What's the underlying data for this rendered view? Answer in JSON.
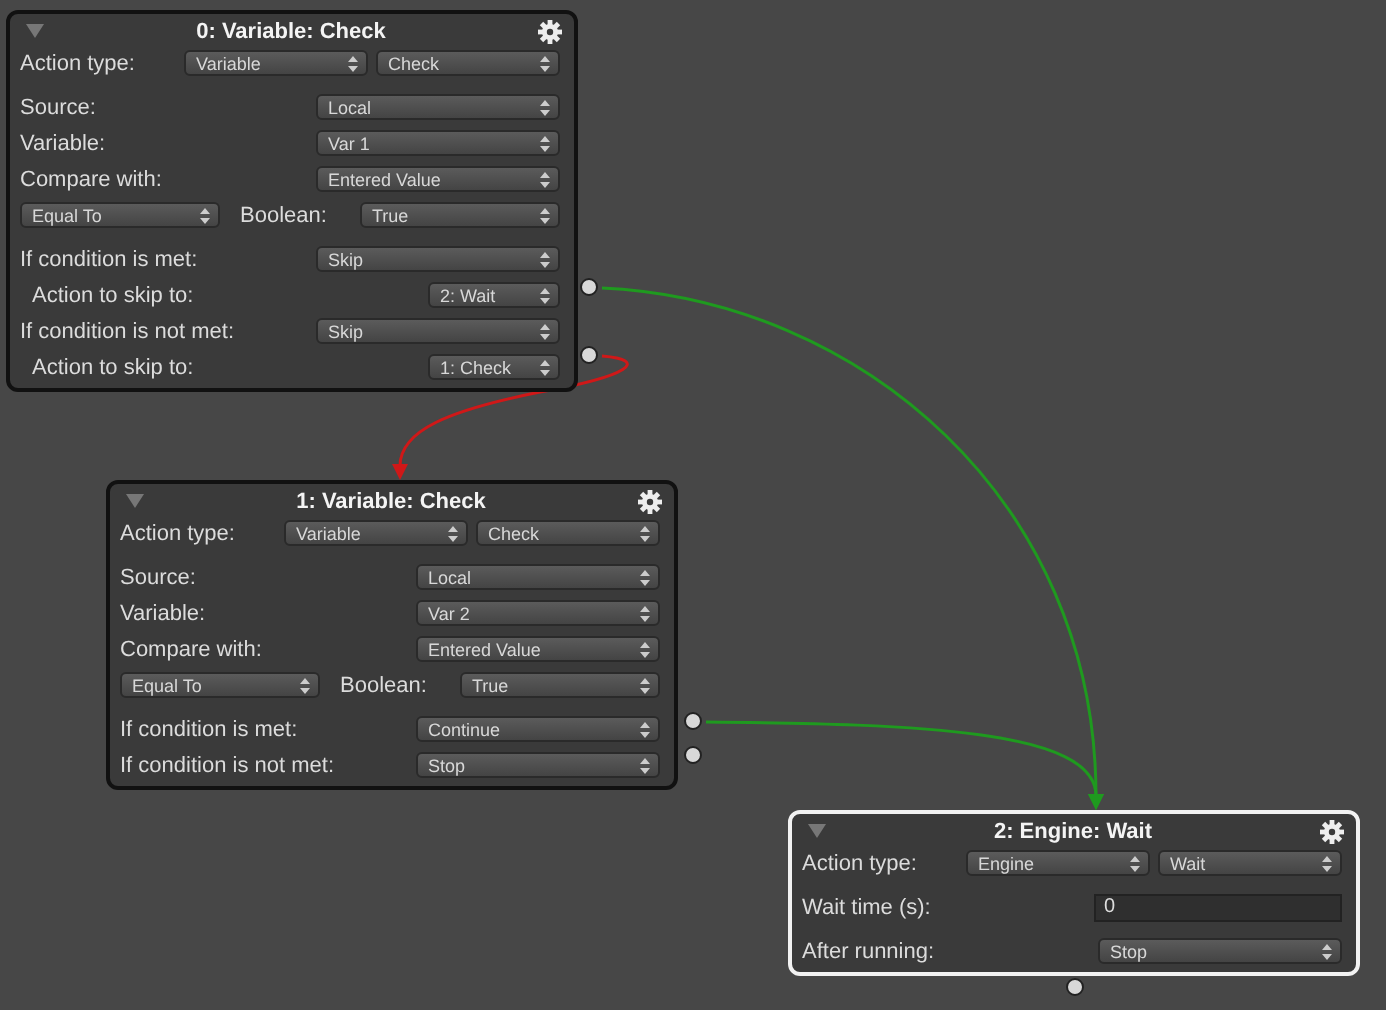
{
  "nodes": [
    {
      "title": "0: Variable: Check",
      "selected": false,
      "sections": [
        [
          {
            "kind": "pair",
            "label": "Action type:",
            "values": [
              "Variable",
              "Check"
            ]
          }
        ],
        [
          {
            "kind": "select",
            "label": "Source:",
            "value": "Local"
          },
          {
            "kind": "select",
            "label": "Variable:",
            "value": "Var 1"
          },
          {
            "kind": "select",
            "label": "Compare with:",
            "value": "Entered Value"
          },
          {
            "kind": "compare",
            "operator": "Equal To",
            "label": "Boolean:",
            "value": "True"
          }
        ],
        [
          {
            "kind": "select",
            "label": "If condition is met:",
            "value": "Skip"
          },
          {
            "kind": "skip",
            "label": "Action to skip to:",
            "value": "2: Wait"
          },
          {
            "kind": "select",
            "label": "If condition is not met:",
            "value": "Skip"
          },
          {
            "kind": "skip",
            "label": "Action to skip to:",
            "value": "1: Check"
          }
        ]
      ]
    },
    {
      "title": "1: Variable: Check",
      "selected": false,
      "sections": [
        [
          {
            "kind": "pair",
            "label": "Action type:",
            "values": [
              "Variable",
              "Check"
            ]
          }
        ],
        [
          {
            "kind": "select",
            "label": "Source:",
            "value": "Local"
          },
          {
            "kind": "select",
            "label": "Variable:",
            "value": "Var 2"
          },
          {
            "kind": "select",
            "label": "Compare with:",
            "value": "Entered Value"
          },
          {
            "kind": "compare",
            "operator": "Equal To",
            "label": "Boolean:",
            "value": "True"
          }
        ],
        [
          {
            "kind": "select",
            "label": "If condition is met:",
            "value": "Continue"
          },
          {
            "kind": "select",
            "label": "If condition is not met:",
            "value": "Stop"
          }
        ]
      ]
    },
    {
      "title": "2: Engine: Wait",
      "selected": true,
      "sections": [
        [
          {
            "kind": "pair",
            "label": "Action type:",
            "values": [
              "Engine",
              "Wait"
            ]
          }
        ],
        [
          {
            "kind": "number",
            "label": "Wait time (s):",
            "value": "0"
          }
        ],
        [
          {
            "kind": "select",
            "label": "After running:",
            "value": "Stop"
          }
        ]
      ]
    }
  ],
  "connections": [
    {
      "color": "#1f9a1f"
    },
    {
      "color": "#d01818"
    },
    {
      "color": "#1f9a1f"
    }
  ]
}
